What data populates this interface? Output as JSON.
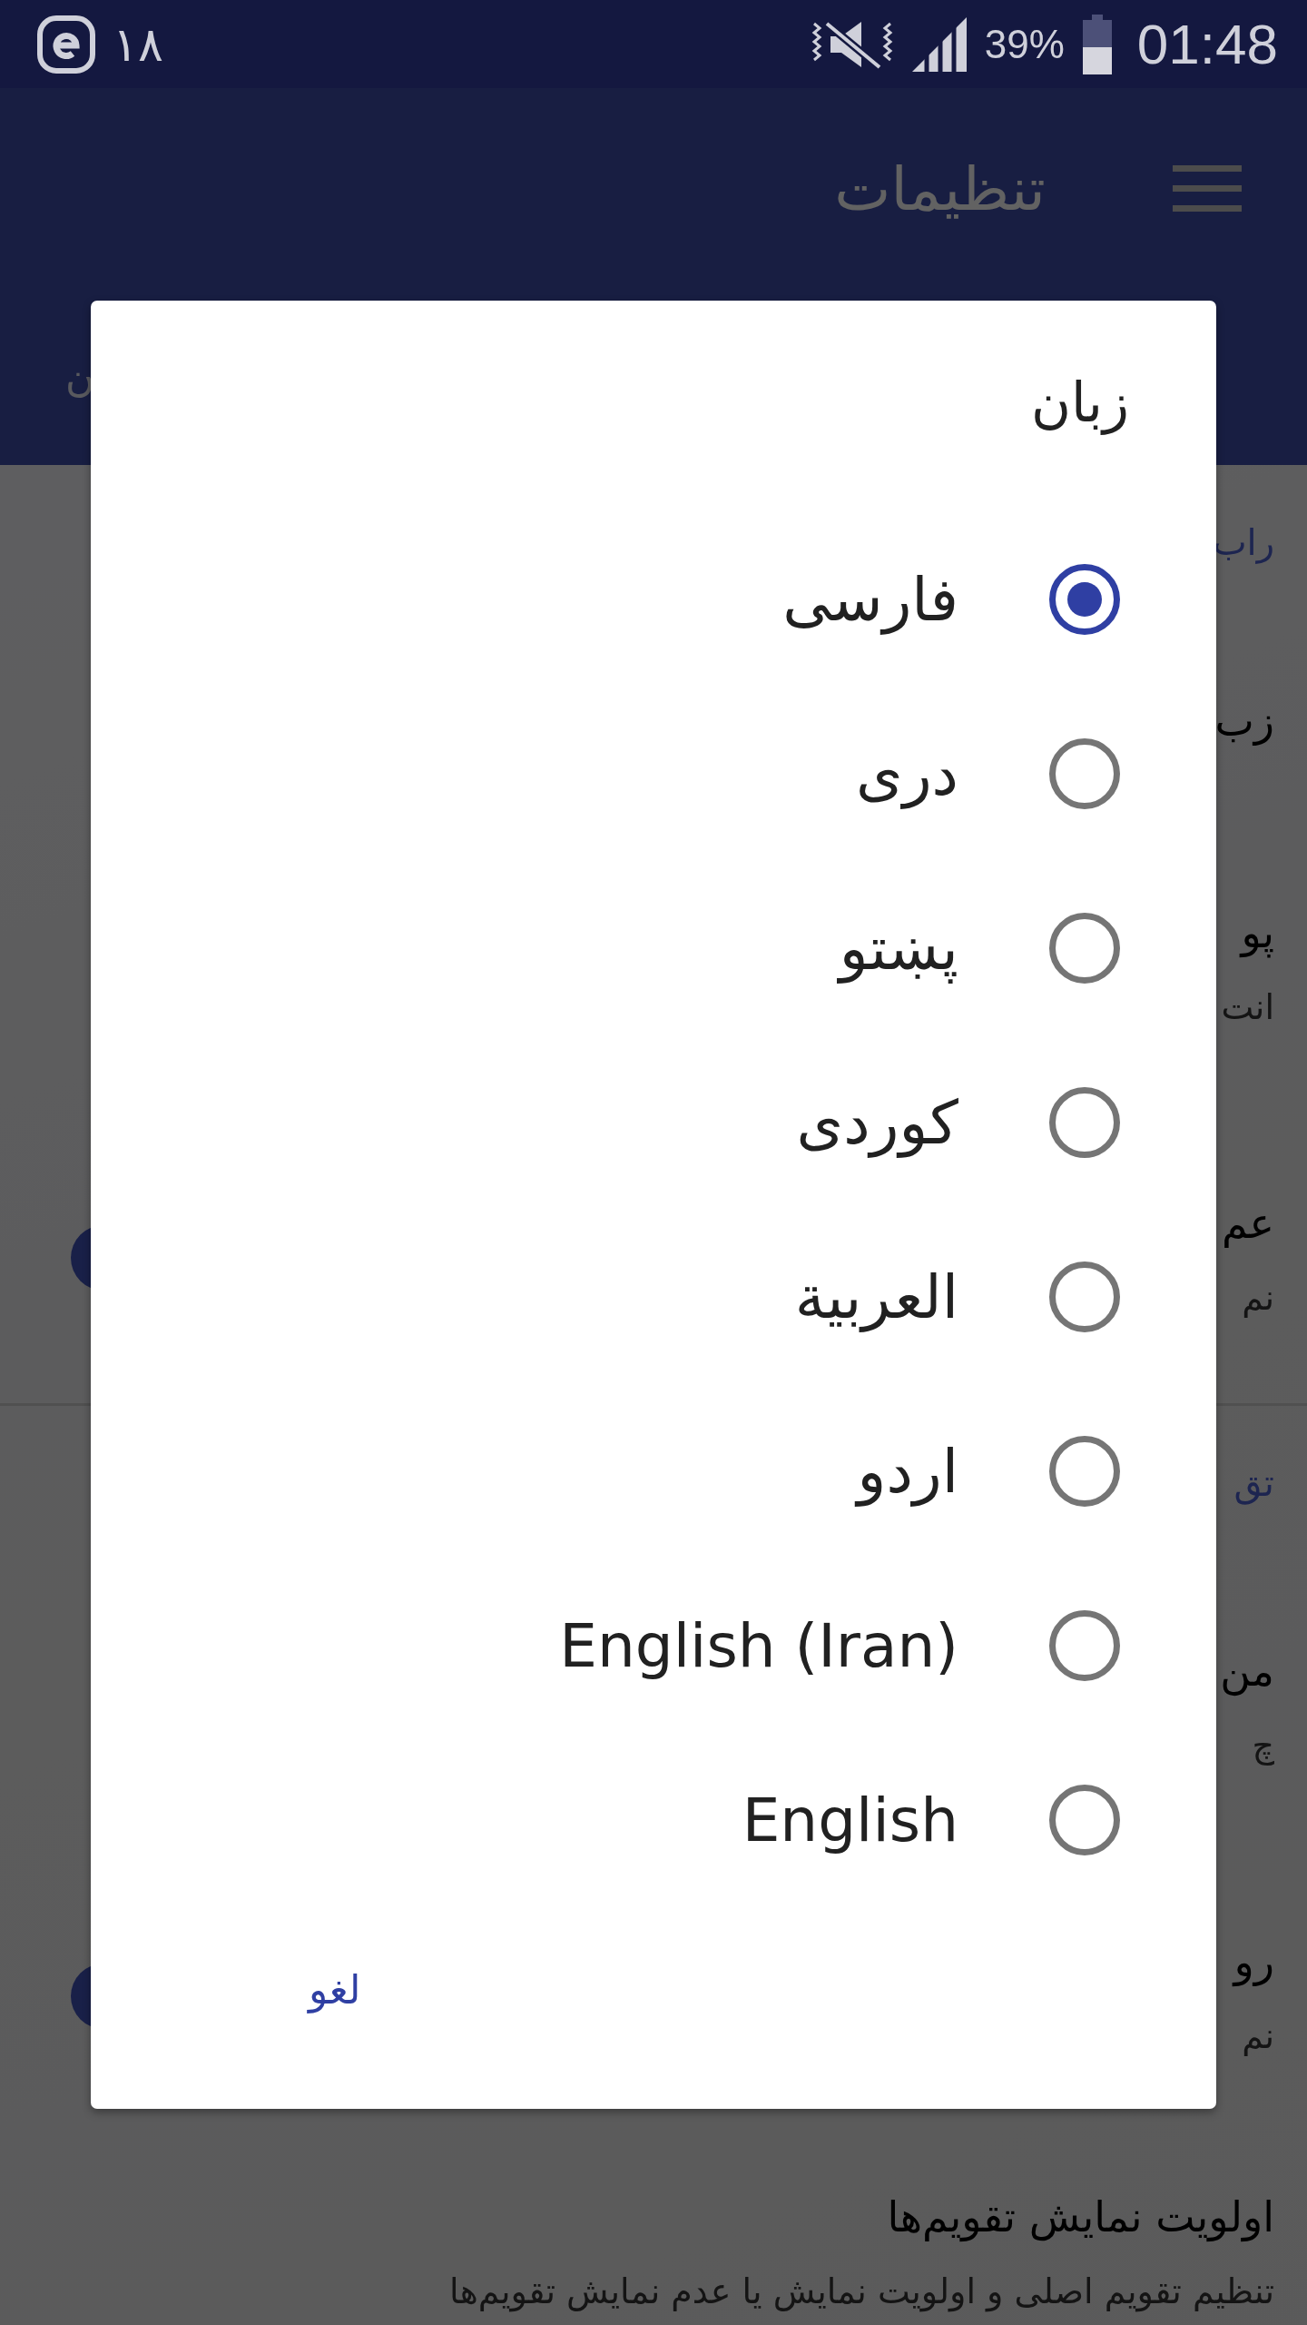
{
  "status_bar": {
    "notification_count": "۱۸",
    "battery": "39%",
    "time": "01:48"
  },
  "app_bar": {
    "title": "تنظیمات",
    "tab_fragment": "ن"
  },
  "sections": [
    {
      "header": "راب",
      "items": [
        {
          "kind": "plain",
          "title": "زب"
        },
        {
          "kind": "plain",
          "title": "پو",
          "subtitle": "انت"
        },
        {
          "kind": "switch",
          "title": "عم",
          "subtitle": "نم",
          "on": true
        }
      ]
    },
    {
      "header": "تق",
      "items": [
        {
          "kind": "plain",
          "title": "من",
          "subtitle": "چ"
        },
        {
          "kind": "switch",
          "title": "رو",
          "subtitle": "نم",
          "on": true
        },
        {
          "kind": "plain",
          "title": "اولویت نمایش تقویم‌ها",
          "subtitle": "تنظیم تقویم اصلی و اولویت نمایش یا عدم نمایش تقویم‌ها"
        }
      ]
    }
  ],
  "dialog": {
    "title": "زبان",
    "options": [
      {
        "label": "فارسی",
        "selected": true
      },
      {
        "label": "دری",
        "selected": false
      },
      {
        "label": "پښتو",
        "selected": false
      },
      {
        "label": "کوردی",
        "selected": false
      },
      {
        "label": "العربیة",
        "selected": false
      },
      {
        "label": "اردو",
        "selected": false
      },
      {
        "label": "English (Iran)",
        "selected": false
      },
      {
        "label": "English",
        "selected": false
      }
    ],
    "buttons": [
      "لغو"
    ]
  }
}
